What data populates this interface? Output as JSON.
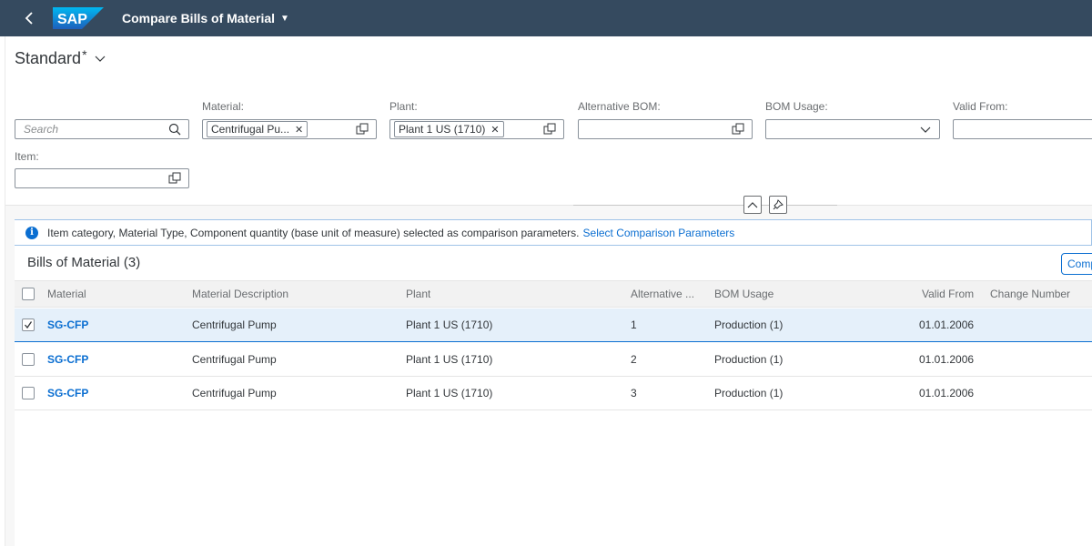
{
  "shell": {
    "logo_text": "SAP",
    "app_title": "Compare Bills of Material"
  },
  "variant": {
    "name": "Standard",
    "modified_mark": "*"
  },
  "filters": {
    "search_placeholder": "Search",
    "material_label": "Material:",
    "material_token": "Centrifugal Pu...",
    "plant_label": "Plant:",
    "plant_token": "Plant 1 US (1710)",
    "alt_bom_label": "Alternative BOM:",
    "bom_usage_label": "BOM Usage:",
    "valid_from_label": "Valid From:",
    "item_label": "Item:"
  },
  "info": {
    "text": "Item category, Material Type, Component quantity (base unit of measure) selected as comparison parameters.",
    "link": "Select Comparison Parameters"
  },
  "table": {
    "title": "Bills of Material (3)",
    "compare_button": "Compare",
    "columns": {
      "material": "Material",
      "description": "Material Description",
      "plant": "Plant",
      "alternative": "Alternative ...",
      "usage": "BOM Usage",
      "valid_from": "Valid From",
      "change_number": "Change Number"
    },
    "rows": [
      {
        "material": "SG-CFP",
        "description": "Centrifugal Pump",
        "plant": "Plant 1 US (1710)",
        "alternative": "1",
        "usage": "Production (1)",
        "valid_from": "01.01.2006",
        "change_number": "",
        "selected": true
      },
      {
        "material": "SG-CFP",
        "description": "Centrifugal Pump",
        "plant": "Plant 1 US (1710)",
        "alternative": "2",
        "usage": "Production (1)",
        "valid_from": "01.01.2006",
        "change_number": "",
        "selected": false
      },
      {
        "material": "SG-CFP",
        "description": "Centrifugal Pump",
        "plant": "Plant 1 US (1710)",
        "alternative": "3",
        "usage": "Production (1)",
        "valid_from": "01.01.2006",
        "change_number": "",
        "selected": false
      }
    ]
  },
  "colors": {
    "shell": "#354a5f",
    "accent": "#0a6ed1",
    "selected_row": "#e5f0fa"
  }
}
